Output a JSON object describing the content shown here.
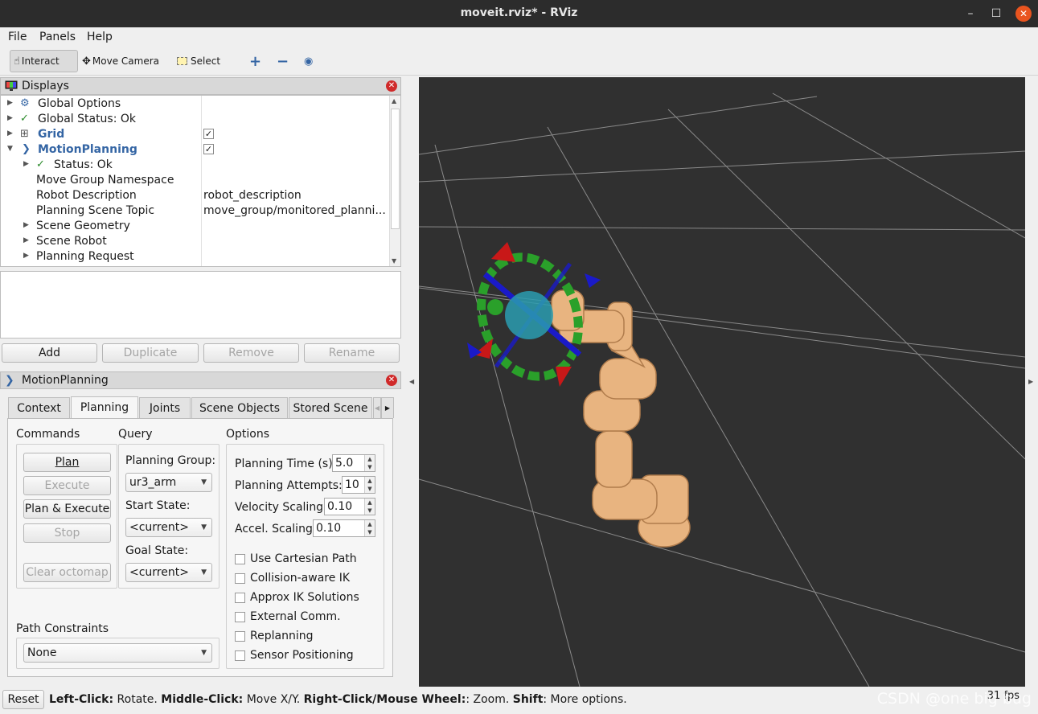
{
  "window": {
    "title": "moveit.rviz* - RViz",
    "min": "–",
    "max": "☐",
    "close": "✕"
  },
  "menu": [
    "File",
    "Panels",
    "Help"
  ],
  "toolbar": {
    "interact": "Interact",
    "move_camera": "Move Camera",
    "select": "Select",
    "add": "+",
    "remove": "−",
    "eye": "◉"
  },
  "displays": {
    "title": "Displays",
    "rows": [
      {
        "name": "Global Options",
        "value": ""
      },
      {
        "name": "Global Status: Ok",
        "value": ""
      },
      {
        "name": "Grid",
        "value": "✓"
      },
      {
        "name": "MotionPlanning",
        "value": "✓"
      },
      {
        "name": "Status: Ok",
        "value": ""
      },
      {
        "name": "Move Group Namespace",
        "value": ""
      },
      {
        "name": "Robot Description",
        "value": "robot_description"
      },
      {
        "name": "Planning Scene Topic",
        "value": "move_group/monitored_planni..."
      },
      {
        "name": "Scene Geometry",
        "value": ""
      },
      {
        "name": "Scene Robot",
        "value": ""
      },
      {
        "name": "Planning Request",
        "value": ""
      }
    ],
    "buttons": {
      "add": "Add",
      "duplicate": "Duplicate",
      "remove": "Remove",
      "rename": "Rename"
    }
  },
  "motion_planning": {
    "title": "MotionPlanning",
    "tabs": [
      "Context",
      "Planning",
      "Joints",
      "Scene Objects",
      "Stored Scene"
    ],
    "selected_tab": "Planning",
    "commands": {
      "title": "Commands",
      "plan": "Plan",
      "execute": "Execute",
      "plan_execute": "Plan & Execute",
      "stop": "Stop",
      "clear_octomap": "Clear octomap"
    },
    "query": {
      "title": "Query",
      "planning_group_label": "Planning Group:",
      "planning_group": "ur3_arm",
      "start_state_label": "Start State:",
      "start_state": "<current>",
      "goal_state_label": "Goal State:",
      "goal_state": "<current>"
    },
    "options": {
      "title": "Options",
      "planning_time_label": "Planning Time (s):",
      "planning_time": "5.0",
      "planning_attempts_label": "Planning Attempts:",
      "planning_attempts": "10",
      "velocity_label": "Velocity Scaling:",
      "velocity": "0.10",
      "accel_label": "Accel. Scaling:",
      "accel": "0.10",
      "checkboxes": [
        "Use Cartesian Path",
        "Collision-aware IK",
        "Approx IK Solutions",
        "External Comm.",
        "Replanning",
        "Sensor Positioning"
      ]
    },
    "path_constraints": {
      "label": "Path Constraints",
      "value": "None"
    }
  },
  "status": {
    "reset": "Reset",
    "left_click": "Left-Click:",
    "left_click_desc": " Rotate. ",
    "middle_click": "Middle-Click:",
    "middle_click_desc": " Move X/Y. ",
    "right_click": "Right-Click/Mouse Wheel:",
    "right_click_desc": ": Zoom. ",
    "shift": "Shift",
    "shift_desc": ": More options.",
    "fps": "31 fps"
  },
  "watermark": "CSDN @one big bug",
  "colors": {
    "robot": "#e8b480",
    "viewport": "#303030",
    "ring_green": "#2aa02a",
    "arrow_red": "#c81818",
    "arrow_blue": "#1a1ac8",
    "accent_blue": "#3465a4"
  }
}
